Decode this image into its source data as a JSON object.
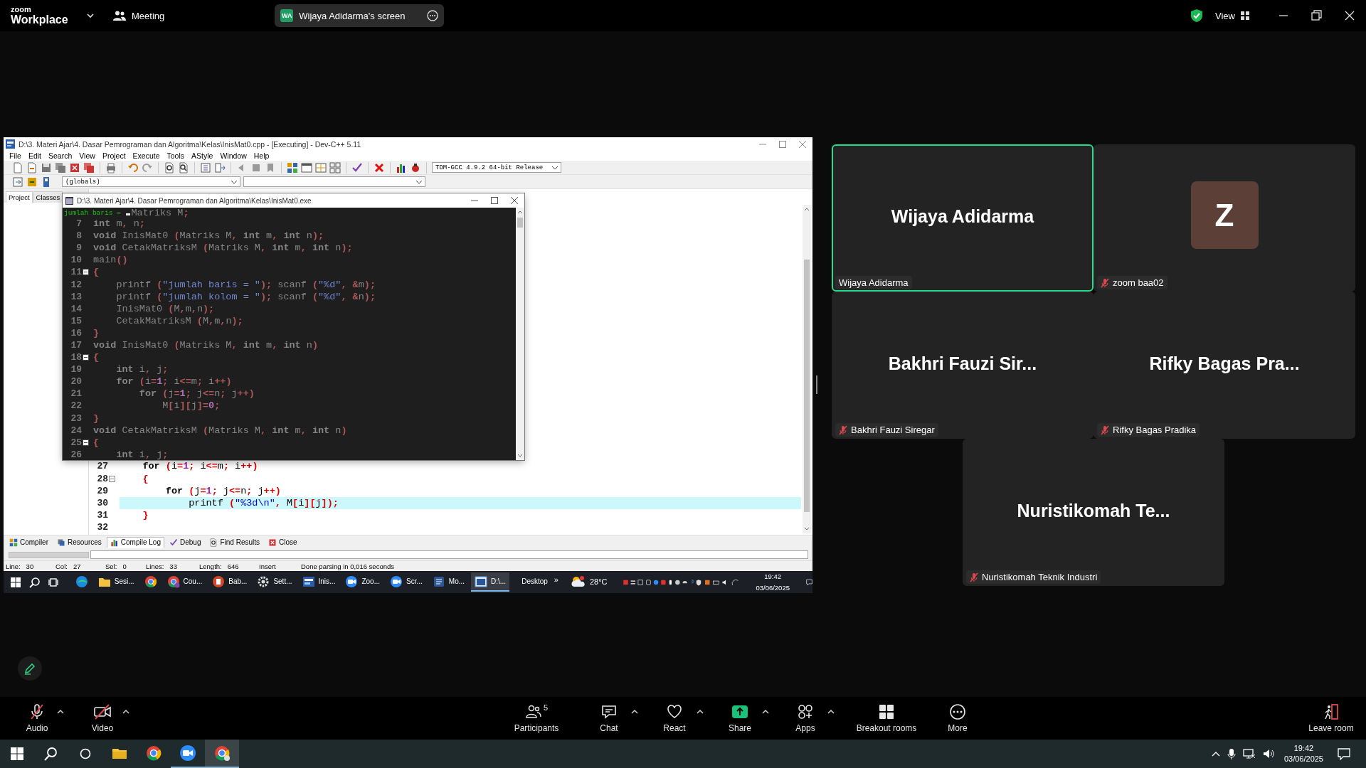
{
  "top_bar": {
    "logo_small": "zoom",
    "logo_name": "Workplace",
    "meeting_menu": "Meeting",
    "share_indicator": {
      "initials": "WA",
      "label": "Wijaya Adidarma's screen"
    },
    "view_button": "View"
  },
  "shared_screen": {
    "ide": {
      "title": "D:\\3. Materi Ajar\\4. Dasar Pemrograman dan Algoritma\\Kelas\\InisMat0.cpp - [Executing] - Dev-C++ 5.11",
      "menu": [
        "File",
        "Edit",
        "Search",
        "View",
        "Project",
        "Execute",
        "Tools",
        "AStyle",
        "Window",
        "Help"
      ],
      "compiler": "TDM-GCC 4.9.2 64-bit Release",
      "scope": "(globals)",
      "side_tabs": [
        {
          "label": "Project",
          "selected": true
        },
        {
          "label": "Classes",
          "selected": false
        }
      ],
      "editor_lines": [
        {
          "number": "27",
          "fold": false,
          "current": false,
          "tokens": [
            {
              "kind": "keyword",
              "text": "    for"
            },
            {
              "kind": "symbol",
              "text": " ("
            },
            {
              "kind": "identifier",
              "text": "i"
            },
            {
              "kind": "symbol",
              "text": "="
            },
            {
              "kind": "number",
              "text": "1"
            },
            {
              "kind": "symbol",
              "text": ";"
            },
            {
              "kind": "identifier",
              "text": " i"
            },
            {
              "kind": "symbol",
              "text": "<="
            },
            {
              "kind": "identifier",
              "text": "m"
            },
            {
              "kind": "symbol",
              "text": ";"
            },
            {
              "kind": "identifier",
              "text": " i"
            },
            {
              "kind": "symbol",
              "text": "++)"
            }
          ]
        },
        {
          "number": "28",
          "fold": true,
          "current": false,
          "tokens": [
            {
              "kind": "symbol",
              "text": "    {"
            }
          ]
        },
        {
          "number": "29",
          "fold": false,
          "current": false,
          "tokens": [
            {
              "kind": "keyword",
              "text": "        for"
            },
            {
              "kind": "symbol",
              "text": " ("
            },
            {
              "kind": "identifier",
              "text": "j"
            },
            {
              "kind": "symbol",
              "text": "="
            },
            {
              "kind": "number",
              "text": "1"
            },
            {
              "kind": "symbol",
              "text": ";"
            },
            {
              "kind": "identifier",
              "text": " j"
            },
            {
              "kind": "symbol",
              "text": "<="
            },
            {
              "kind": "identifier",
              "text": "n"
            },
            {
              "kind": "symbol",
              "text": ";"
            },
            {
              "kind": "identifier",
              "text": " j"
            },
            {
              "kind": "symbol",
              "text": "++)"
            }
          ]
        },
        {
          "number": "30",
          "fold": false,
          "current": true,
          "tokens": [
            {
              "kind": "identifier",
              "text": "            printf "
            },
            {
              "kind": "symbol",
              "text": "("
            },
            {
              "kind": "string",
              "text": "\"%3d\\n\""
            },
            {
              "kind": "symbol",
              "text": ", "
            },
            {
              "kind": "identifier",
              "text": "M"
            },
            {
              "kind": "symbol",
              "text": "["
            },
            {
              "kind": "identifier",
              "text": "i"
            },
            {
              "kind": "symbol",
              "text": "]["
            },
            {
              "kind": "identifier",
              "text": "j"
            },
            {
              "kind": "symbol",
              "text": "]);"
            }
          ]
        },
        {
          "number": "31",
          "fold": false,
          "current": false,
          "tokens": [
            {
              "kind": "symbol",
              "text": "    }"
            }
          ]
        },
        {
          "number": "32",
          "fold": false,
          "current": false
        }
      ],
      "bottom_tabs": [
        {
          "label": "Compiler",
          "selected": false
        },
        {
          "label": "Resources",
          "selected": false
        },
        {
          "label": "Compile Log",
          "selected": true
        },
        {
          "label": "Debug",
          "selected": false
        },
        {
          "label": "Find Results",
          "selected": false
        },
        {
          "label": "Close",
          "selected": false
        }
      ],
      "status": [
        {
          "label": "Line:",
          "value": "30"
        },
        {
          "label": "Col:",
          "value": "27"
        },
        {
          "label": "Sel:",
          "value": "0"
        },
        {
          "label": "Lines:",
          "value": "33"
        },
        {
          "label": "Length:",
          "value": "646"
        },
        {
          "label": "Insert"
        },
        {
          "label": "Done parsing in 0,016 seconds"
        }
      ]
    },
    "console": {
      "title": "D:\\3. Materi Ajar\\4. Dasar Pemrograman dan Algoritma\\Kelas\\InisMat0.exe",
      "output": "jumlah baris = ",
      "first_line": [
        {
          "kind": "identifier",
          "text": "Matriks M"
        },
        {
          "kind": "symbol",
          "text": ";"
        }
      ],
      "lines": [
        {
          "number": "7",
          "fold": false,
          "tokens": [
            {
              "kind": "keyword",
              "text": "int"
            },
            {
              "kind": "identifier",
              "text": " m"
            },
            {
              "kind": "symbol",
              "text": ","
            },
            {
              "kind": "identifier",
              "text": " n"
            },
            {
              "kind": "symbol",
              "text": ";"
            }
          ]
        },
        {
          "number": "8",
          "fold": false,
          "tokens": [
            {
              "kind": "keyword",
              "text": "void"
            },
            {
              "kind": "identifier",
              "text": " InisMat0 "
            },
            {
              "kind": "symbol",
              "text": "("
            },
            {
              "kind": "identifier",
              "text": "Matriks M"
            },
            {
              "kind": "symbol",
              "text": ","
            },
            {
              "kind": "keyword",
              "text": " int"
            },
            {
              "kind": "identifier",
              "text": " m"
            },
            {
              "kind": "symbol",
              "text": ","
            },
            {
              "kind": "keyword",
              "text": " int"
            },
            {
              "kind": "identifier",
              "text": " n"
            },
            {
              "kind": "symbol",
              "text": ");"
            }
          ]
        },
        {
          "number": "9",
          "fold": false,
          "tokens": [
            {
              "kind": "keyword",
              "text": "void"
            },
            {
              "kind": "identifier",
              "text": " CetakMatriksM "
            },
            {
              "kind": "symbol",
              "text": "("
            },
            {
              "kind": "identifier",
              "text": "Matriks M"
            },
            {
              "kind": "symbol",
              "text": ","
            },
            {
              "kind": "keyword",
              "text": " int"
            },
            {
              "kind": "identifier",
              "text": " m"
            },
            {
              "kind": "symbol",
              "text": ","
            },
            {
              "kind": "keyword",
              "text": " int"
            },
            {
              "kind": "identifier",
              "text": " n"
            },
            {
              "kind": "symbol",
              "text": ");"
            }
          ]
        },
        {
          "number": "10",
          "fold": false,
          "tokens": [
            {
              "kind": "identifier",
              "text": "main"
            },
            {
              "kind": "symbol",
              "text": "()"
            }
          ]
        },
        {
          "number": "11",
          "fold": true,
          "tokens": [
            {
              "kind": "symbol",
              "text": "{"
            }
          ]
        },
        {
          "number": "12",
          "fold": false,
          "tokens": [
            {
              "kind": "identifier",
              "text": "    printf "
            },
            {
              "kind": "symbol",
              "text": "("
            },
            {
              "kind": "string",
              "text": "\"jumlah baris = \""
            },
            {
              "kind": "symbol",
              "text": ");"
            },
            {
              "kind": "identifier",
              "text": " scanf "
            },
            {
              "kind": "symbol",
              "text": "("
            },
            {
              "kind": "string",
              "text": "\"%d\""
            },
            {
              "kind": "symbol",
              "text": ", &"
            },
            {
              "kind": "identifier",
              "text": "m"
            },
            {
              "kind": "symbol",
              "text": ");"
            }
          ]
        },
        {
          "number": "13",
          "fold": false,
          "tokens": [
            {
              "kind": "identifier",
              "text": "    printf "
            },
            {
              "kind": "symbol",
              "text": "("
            },
            {
              "kind": "string",
              "text": "\"jumlah kolom = \""
            },
            {
              "kind": "symbol",
              "text": ");"
            },
            {
              "kind": "identifier",
              "text": " scanf "
            },
            {
              "kind": "symbol",
              "text": "("
            },
            {
              "kind": "string",
              "text": "\"%d\""
            },
            {
              "kind": "symbol",
              "text": ", &"
            },
            {
              "kind": "identifier",
              "text": "n"
            },
            {
              "kind": "symbol",
              "text": ");"
            }
          ]
        },
        {
          "number": "14",
          "fold": false,
          "tokens": [
            {
              "kind": "identifier",
              "text": "    InisMat0 "
            },
            {
              "kind": "symbol",
              "text": "("
            },
            {
              "kind": "identifier",
              "text": "M"
            },
            {
              "kind": "symbol",
              "text": ","
            },
            {
              "kind": "identifier",
              "text": "m"
            },
            {
              "kind": "symbol",
              "text": ","
            },
            {
              "kind": "identifier",
              "text": "n"
            },
            {
              "kind": "symbol",
              "text": ");"
            }
          ]
        },
        {
          "number": "15",
          "fold": false,
          "tokens": [
            {
              "kind": "identifier",
              "text": "    CetakMatriksM "
            },
            {
              "kind": "symbol",
              "text": "("
            },
            {
              "kind": "identifier",
              "text": "M"
            },
            {
              "kind": "symbol",
              "text": ","
            },
            {
              "kind": "identifier",
              "text": "m"
            },
            {
              "kind": "symbol",
              "text": ","
            },
            {
              "kind": "identifier",
              "text": "n"
            },
            {
              "kind": "symbol",
              "text": ");"
            }
          ]
        },
        {
          "number": "16",
          "fold": false,
          "tokens": [
            {
              "kind": "symbol",
              "text": "}"
            }
          ]
        },
        {
          "number": "17",
          "fold": false,
          "tokens": [
            {
              "kind": "keyword",
              "text": "void"
            },
            {
              "kind": "identifier",
              "text": " InisMat0 "
            },
            {
              "kind": "symbol",
              "text": "("
            },
            {
              "kind": "identifier",
              "text": "Matriks M"
            },
            {
              "kind": "symbol",
              "text": ","
            },
            {
              "kind": "keyword",
              "text": " int"
            },
            {
              "kind": "identifier",
              "text": " m"
            },
            {
              "kind": "symbol",
              "text": ","
            },
            {
              "kind": "keyword",
              "text": " int"
            },
            {
              "kind": "identifier",
              "text": " n"
            },
            {
              "kind": "symbol",
              "text": ")"
            }
          ]
        },
        {
          "number": "18",
          "fold": true,
          "tokens": [
            {
              "kind": "symbol",
              "text": "{"
            }
          ]
        },
        {
          "number": "19",
          "fold": false,
          "tokens": [
            {
              "kind": "keyword",
              "text": "    int"
            },
            {
              "kind": "identifier",
              "text": " i"
            },
            {
              "kind": "symbol",
              "text": ","
            },
            {
              "kind": "identifier",
              "text": " j"
            },
            {
              "kind": "symbol",
              "text": ";"
            }
          ]
        },
        {
          "number": "20",
          "fold": false,
          "tokens": [
            {
              "kind": "keyword",
              "text": "    for"
            },
            {
              "kind": "symbol",
              "text": " ("
            },
            {
              "kind": "identifier",
              "text": "i"
            },
            {
              "kind": "symbol",
              "text": "="
            },
            {
              "kind": "number",
              "text": "1"
            },
            {
              "kind": "symbol",
              "text": ";"
            },
            {
              "kind": "identifier",
              "text": " i"
            },
            {
              "kind": "symbol",
              "text": "<="
            },
            {
              "kind": "identifier",
              "text": "m"
            },
            {
              "kind": "symbol",
              "text": ";"
            },
            {
              "kind": "identifier",
              "text": " i"
            },
            {
              "kind": "symbol",
              "text": "++)"
            }
          ]
        },
        {
          "number": "21",
          "fold": false,
          "tokens": [
            {
              "kind": "keyword",
              "text": "        for"
            },
            {
              "kind": "symbol",
              "text": " ("
            },
            {
              "kind": "identifier",
              "text": "j"
            },
            {
              "kind": "symbol",
              "text": "="
            },
            {
              "kind": "number",
              "text": "1"
            },
            {
              "kind": "symbol",
              "text": ";"
            },
            {
              "kind": "identifier",
              "text": " j"
            },
            {
              "kind": "symbol",
              "text": "<="
            },
            {
              "kind": "identifier",
              "text": "n"
            },
            {
              "kind": "symbol",
              "text": ";"
            },
            {
              "kind": "identifier",
              "text": " j"
            },
            {
              "kind": "symbol",
              "text": "++)"
            }
          ]
        },
        {
          "number": "22",
          "fold": false,
          "tokens": [
            {
              "kind": "identifier",
              "text": "            M"
            },
            {
              "kind": "symbol",
              "text": "["
            },
            {
              "kind": "identifier",
              "text": "i"
            },
            {
              "kind": "symbol",
              "text": "]["
            },
            {
              "kind": "identifier",
              "text": "j"
            },
            {
              "kind": "symbol",
              "text": "]="
            },
            {
              "kind": "number",
              "text": "0"
            },
            {
              "kind": "symbol",
              "text": ";"
            }
          ]
        },
        {
          "number": "23",
          "fold": false,
          "tokens": [
            {
              "kind": "symbol",
              "text": "}"
            }
          ]
        },
        {
          "number": "24",
          "fold": false,
          "tokens": [
            {
              "kind": "keyword",
              "text": "void"
            },
            {
              "kind": "identifier",
              "text": " CetakMatriksM "
            },
            {
              "kind": "symbol",
              "text": "("
            },
            {
              "kind": "identifier",
              "text": "Matriks M"
            },
            {
              "kind": "symbol",
              "text": ","
            },
            {
              "kind": "keyword",
              "text": " int"
            },
            {
              "kind": "identifier",
              "text": " m"
            },
            {
              "kind": "symbol",
              "text": ","
            },
            {
              "kind": "keyword",
              "text": " int"
            },
            {
              "kind": "identifier",
              "text": " n"
            },
            {
              "kind": "symbol",
              "text": ")"
            }
          ]
        },
        {
          "number": "25",
          "fold": true,
          "tokens": [
            {
              "kind": "symbol",
              "text": "{"
            }
          ]
        },
        {
          "number": "26",
          "fold": false,
          "tokens": [
            {
              "kind": "keyword",
              "text": "    int"
            },
            {
              "kind": "identifier",
              "text": " i"
            },
            {
              "kind": "symbol",
              "text": ","
            },
            {
              "kind": "identifier",
              "text": " j"
            },
            {
              "kind": "symbol",
              "text": ";"
            }
          ]
        }
      ]
    },
    "taskbar": {
      "apps": [
        {
          "selected": false
        },
        {
          "label": "Sesi...",
          "selected": false
        },
        {
          "selected": false
        },
        {
          "label": "Cou...",
          "selected": false
        },
        {
          "label": "Bab...",
          "selected": false
        },
        {
          "label": "Sett...",
          "selected": false
        },
        {
          "label": "Inis...",
          "selected": false
        },
        {
          "label": "Zoo...",
          "selected": false
        },
        {
          "label": "Scr...",
          "selected": false
        },
        {
          "label": "Mo...",
          "selected": false
        },
        {
          "label": "D:\\...",
          "selected": true
        }
      ],
      "toolbar_label": "Desktop",
      "toolbar_overflow": "»",
      "weather": "28°C",
      "time": "19:42",
      "date": "03/06/2025"
    }
  },
  "gallery": {
    "tiles": [
      {
        "display_name": "Wijaya Adidarma",
        "name_tag": "Wijaya Adidarma",
        "muted": false,
        "active_speaker": true
      },
      {
        "avatar_initial": "Z",
        "name_tag": "zoom baa02",
        "muted": true,
        "active_speaker": false
      },
      {
        "display_name": "Bakhri Fauzi Sir...",
        "name_tag": "Bakhri Fauzi Siregar",
        "muted": true,
        "active_speaker": false
      },
      {
        "display_name": "Rifky Bagas Pra...",
        "name_tag": "Rifky Bagas Pradika",
        "muted": true,
        "active_speaker": false
      },
      {
        "display_name": "Nuristikomah Te...",
        "name_tag": "Nuristikomah Teknik Industri",
        "muted": true,
        "active_speaker": false
      }
    ]
  },
  "meeting_toolbar": {
    "controls": [
      {
        "kind": "audio",
        "label": "Audio",
        "muted": true,
        "caret": true
      },
      {
        "kind": "video",
        "label": "Video",
        "muted": true,
        "caret": true
      },
      {
        "kind": "participants",
        "label": "Participants",
        "count": "5",
        "caret": false
      },
      {
        "kind": "chat",
        "label": "Chat",
        "caret": true
      },
      {
        "kind": "react",
        "label": "React",
        "caret": true
      },
      {
        "kind": "share",
        "label": "Share",
        "caret": true
      },
      {
        "kind": "apps",
        "label": "Apps",
        "caret": true
      },
      {
        "kind": "breakout",
        "label": "Breakout rooms",
        "caret": false
      },
      {
        "kind": "more",
        "label": "More",
        "caret": false
      },
      {
        "kind": "leave",
        "label": "Leave room",
        "caret": false
      }
    ]
  },
  "windows_taskbar": {
    "apps": [
      {
        "running": false,
        "selected": false
      },
      {
        "running": false,
        "selected": false
      },
      {
        "running": true,
        "selected": false
      },
      {
        "running": true,
        "selected": true
      }
    ],
    "time": "19:42",
    "date": "03/06/2025"
  }
}
